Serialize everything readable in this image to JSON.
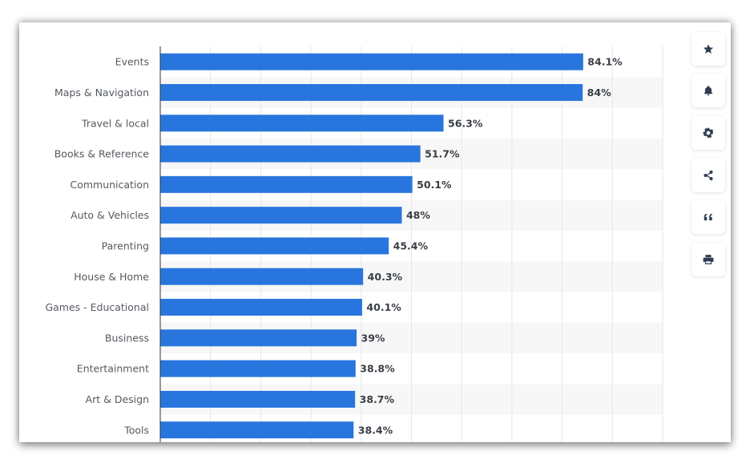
{
  "chart_data": {
    "type": "bar",
    "orientation": "horizontal",
    "title": "",
    "xlabel": "",
    "ylabel": "",
    "xlim": [
      0,
      100
    ],
    "grid": true,
    "bar_color": "#2876dd",
    "categories": [
      "Events",
      "Maps & Navigation",
      "Travel & local",
      "Books & Reference",
      "Communication",
      "Auto & Vehicles",
      "Parenting",
      "House & Home",
      "Games - Educational",
      "Business",
      "Entertainment",
      "Art & Design",
      "Tools"
    ],
    "values": [
      84.1,
      84,
      56.3,
      51.7,
      50.1,
      48,
      45.4,
      40.3,
      40.1,
      39,
      38.8,
      38.7,
      38.4
    ],
    "value_labels": [
      "84.1%",
      "84%",
      "56.3%",
      "51.7%",
      "50.1%",
      "48%",
      "45.4%",
      "40.3%",
      "40.1%",
      "39%",
      "38.8%",
      "38.7%",
      "38.4%"
    ]
  },
  "toolbar": {
    "buttons": [
      {
        "name": "favorite-button",
        "icon": "star-icon"
      },
      {
        "name": "notification-button",
        "icon": "bell-icon"
      },
      {
        "name": "settings-button",
        "icon": "gear-icon"
      },
      {
        "name": "share-button",
        "icon": "share-icon"
      },
      {
        "name": "cite-button",
        "icon": "quote-icon"
      },
      {
        "name": "print-button",
        "icon": "print-icon"
      }
    ]
  }
}
